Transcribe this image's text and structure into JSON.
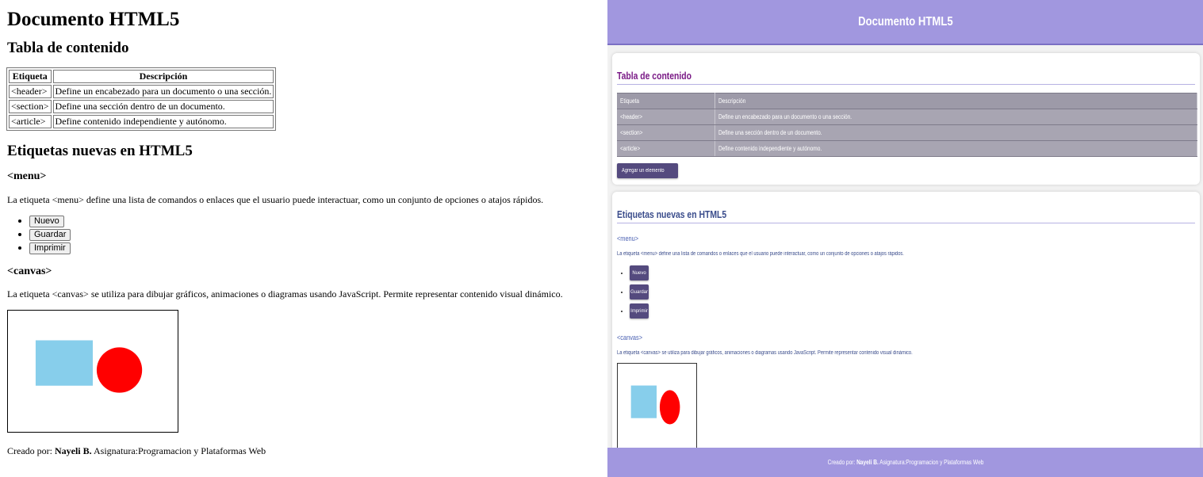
{
  "document": {
    "title": "Documento HTML5",
    "toc_heading": "Tabla de contenido",
    "table": {
      "headers": [
        "Etiqueta",
        "Descripción"
      ],
      "rows": [
        [
          "<header>",
          "Define un encabezado para un documento o una sección."
        ],
        [
          "<section>",
          "Define una sección dentro de un documento."
        ],
        [
          "<article>",
          "Define contenido independiente y autónomo."
        ]
      ]
    },
    "add_button_label": "Agregar un elemento",
    "new_tags_heading": "Etiquetas nuevas en HTML5",
    "menu_heading": "<menu>",
    "menu_description": "La etiqueta <menu> define una lista de comandos o enlaces que el usuario puede interactuar, como un conjunto de opciones o atajos rápidos.",
    "menu_buttons": [
      "Nuevo",
      "Guardar",
      "Imprimir"
    ],
    "canvas_heading": "<canvas>",
    "canvas_description": "La etiqueta <canvas> se utiliza para dibujar gráficos, animaciones o diagramas usando JavaScript. Permite representar contenido visual dinámico.",
    "footer": {
      "prefix": "Creado por: ",
      "author": "Nayeli B.",
      "suffix": " Asignatura:Programacion y Plataformas Web"
    }
  },
  "colors": {
    "canvas_rect": "#87ceeb",
    "canvas_circle": "#ff0000",
    "styled_header_bg": "#a197df",
    "styled_button_bg": "#544a7e",
    "styled_table_bg": "#a8a5b2",
    "styled_toc_heading": "#7a1a86",
    "styled_section_heading": "#3b4d8c"
  }
}
